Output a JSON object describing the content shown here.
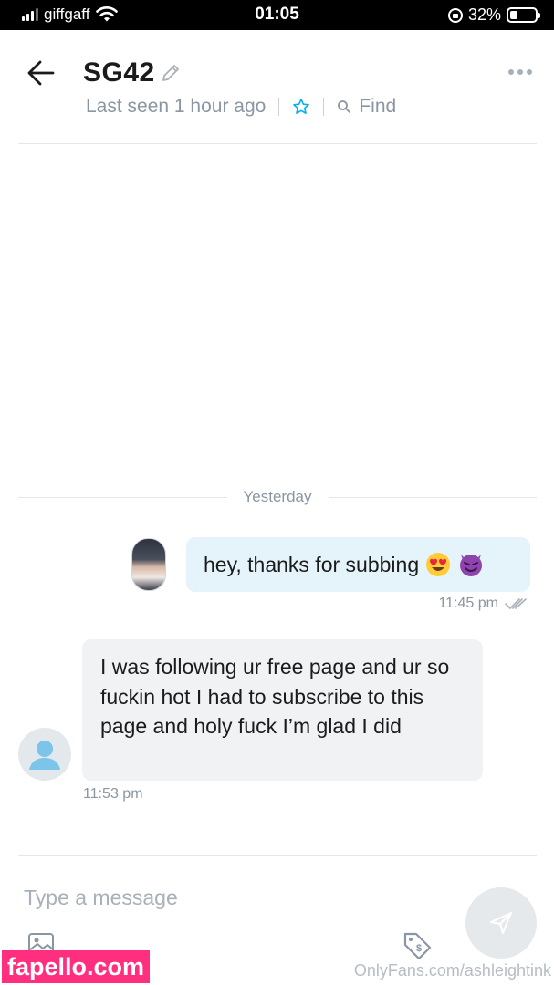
{
  "status_bar": {
    "carrier": "giffgaff",
    "time": "01:05",
    "battery": "32%",
    "battery_level": 0.32
  },
  "header": {
    "title": "SG42",
    "last_seen": "Last seen 1 hour ago",
    "find_label": "Find"
  },
  "chat": {
    "date_divider": "Yesterday",
    "messages": [
      {
        "direction": "outgoing",
        "text": "hey, thanks for subbing",
        "emojis": [
          "heart-eyes-emoji",
          "smiling-devil-emoji"
        ],
        "time": "11:45 pm"
      },
      {
        "direction": "incoming",
        "text": "I was following ur free page and ur so fuckin hot I had to subscribe to this page and holy fuck I’m glad I did",
        "time": "11:53 pm"
      }
    ]
  },
  "composer": {
    "placeholder": "Type a message"
  },
  "watermarks": {
    "left": "fapello.com",
    "right": "OnlyFans.com/ashleightink"
  },
  "colors": {
    "accent": "#00aff0",
    "outgoing_bubble": "#e5f4fb",
    "incoming_bubble": "#f0f2f3",
    "muted_text": "#8a96a3",
    "watermark_pink": "#ff2e7e"
  }
}
